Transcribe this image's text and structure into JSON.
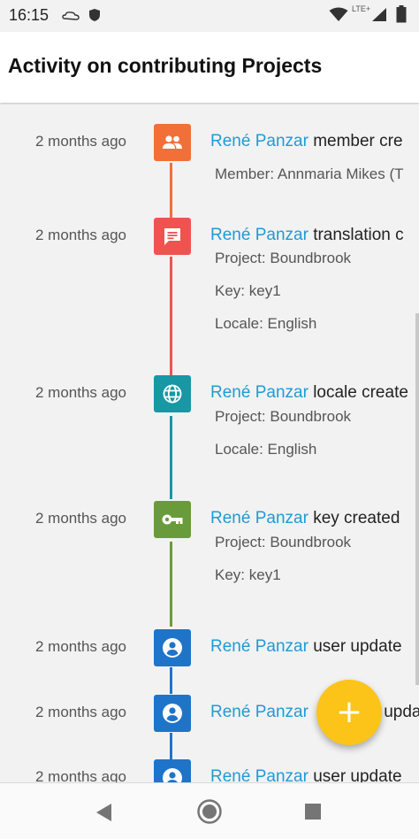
{
  "status_bar": {
    "time": "16:15",
    "network": "LTE+"
  },
  "page_title": "Activity on contributing Projects",
  "colors": {
    "link": "#1e9bd6",
    "fab": "#fcc419"
  },
  "activities": [
    {
      "time": "2 months ago",
      "user": "René Panzar",
      "action": "member cre",
      "icon": "people-icon",
      "color": "#f26f37",
      "details": [
        "Member: Annmaria Mikes (T"
      ]
    },
    {
      "time": "2 months ago",
      "user": "René Panzar",
      "action": "translation c",
      "icon": "comment-icon",
      "color": "#ef5350",
      "details": [
        "Project: Boundbrook",
        "Key: key1",
        "Locale: English"
      ]
    },
    {
      "time": "2 months ago",
      "user": "René Panzar",
      "action": "locale create",
      "icon": "globe-icon",
      "color": "#1897a5",
      "details": [
        "Project: Boundbrook",
        "Locale: English"
      ]
    },
    {
      "time": "2 months ago",
      "user": "René Panzar",
      "action": "key created",
      "icon": "key-icon",
      "color": "#6a9b3a",
      "details": [
        "Project: Boundbrook",
        "Key: key1"
      ]
    },
    {
      "time": "2 months ago",
      "user": "René Panzar",
      "action": "user update",
      "icon": "account-icon",
      "color": "#1e74c9",
      "details": []
    },
    {
      "time": "2 months ago",
      "user": "René Panzar",
      "action": "update",
      "icon": "account-icon",
      "color": "#1e74c9",
      "details": []
    },
    {
      "time": "2 months ago",
      "user": "René Panzar",
      "action": "user update",
      "icon": "account-icon",
      "color": "#1e74c9",
      "details": []
    }
  ],
  "fab": {
    "icon": "plus-icon",
    "label": "+"
  },
  "nav": {
    "back": "back-icon",
    "home": "home-icon",
    "recents": "recents-icon"
  }
}
